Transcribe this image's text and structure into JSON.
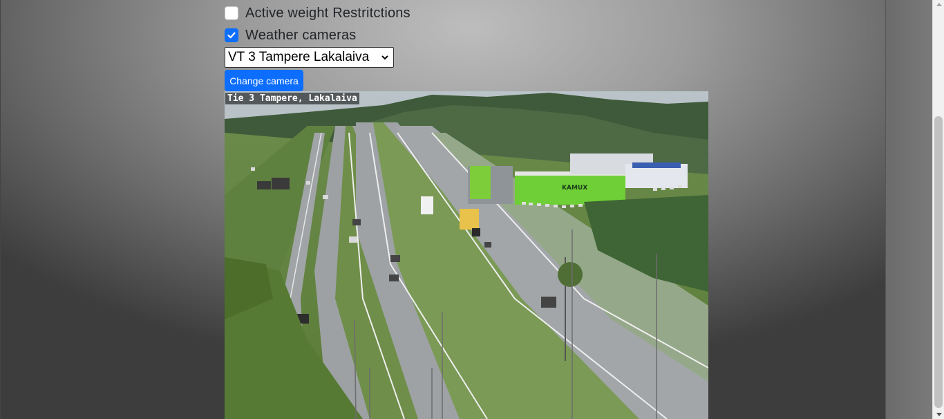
{
  "filters": {
    "weight_restrictions": {
      "label": "Active weight Restritctions",
      "checked": false
    },
    "weather_cameras": {
      "label": "Weather cameras",
      "checked": true
    }
  },
  "camera_select": {
    "selected": "VT 3 Tampere Lakalaiva"
  },
  "change_button": {
    "label": "Change camera"
  },
  "camera_image": {
    "caption": "Tie 3 Tampere, Lakalaiva",
    "building_sign": "KAMUX"
  },
  "colors": {
    "accent": "#0d6efd"
  }
}
